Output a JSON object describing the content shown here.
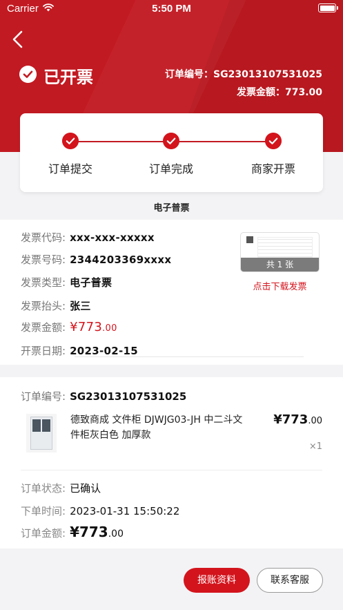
{
  "status_bar": {
    "carrier": "Carrier",
    "time": "5:50 PM"
  },
  "header": {
    "status_title": "已开票",
    "order_no_label": "订单编号：",
    "order_no": "SG23013107531025",
    "invoice_amount_label": "发票金额：",
    "invoice_amount": "773.00"
  },
  "progress": {
    "steps": [
      {
        "label": "订单提交"
      },
      {
        "label": "订单完成"
      },
      {
        "label": "商家开票"
      }
    ]
  },
  "invoice_type_title": "电子普票",
  "invoice": {
    "code_label": "发票代码:",
    "code": "xxx-xxx-xxxxx",
    "number_label": "发票号码:",
    "number": "2344203369xxxx",
    "type_label": "发票类型:",
    "type": "电子普票",
    "title_label": "发票抬头:",
    "title": "张三",
    "amount_label": "发票金额:",
    "amount_int": "¥773",
    "amount_dec": ".00",
    "date_label": "开票日期:",
    "date": "2023-02-15",
    "thumb_count": "共 1 张",
    "download_link": "点击下载发票"
  },
  "order": {
    "no_label": "订单编号:",
    "no": "SG23013107531025",
    "product": {
      "name": "德致商成 文件柜 DJWJG03-JH 中二斗文件柜灰白色 加厚款",
      "price_int": "¥773",
      "price_dec": ".00",
      "qty": "×1"
    },
    "status_label": "订单状态:",
    "status": "已确认",
    "time_label": "下单时间:",
    "time": "2023-01-31 15:50:22",
    "amount_label": "订单金额:",
    "amount_int": "¥773",
    "amount_dec": ".00"
  },
  "buttons": {
    "primary": "报账资料",
    "secondary": "联系客服"
  },
  "colors": {
    "brand_red": "#c21a22",
    "accent_red": "#d3141c"
  }
}
